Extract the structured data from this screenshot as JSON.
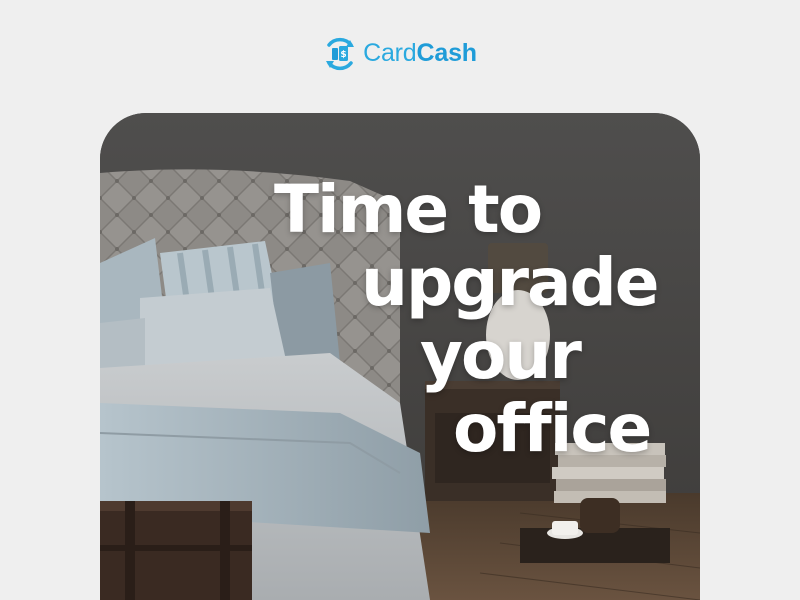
{
  "brand": {
    "name_part1": "Card",
    "name_part2": "Cash",
    "color": "#1f9cd8",
    "icon": "cardcash-logo-icon"
  },
  "hero": {
    "headline": [
      "Time to",
      "upgrade",
      "your",
      "office"
    ],
    "image_subject": "bedroom-with-tufted-headboard-and-nightstand"
  },
  "colors": {
    "page_background": "#efefef",
    "headline_text": "#ffffff"
  }
}
